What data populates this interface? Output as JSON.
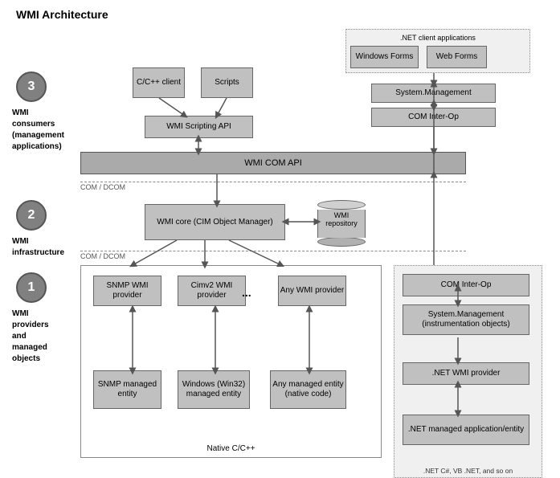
{
  "title": "WMI Architecture",
  "sections": {
    "consumers": {
      "number": "3",
      "label": "WMI consumers\n(management\napplications)"
    },
    "infrastructure": {
      "number": "2",
      "label": "WMI infrastructure"
    },
    "providers": {
      "number": "1",
      "label": "WMI providers\nand\nmanaged\nobjects"
    }
  },
  "boxes": {
    "ccpp_client": "C/C++\nclient",
    "scripts": "Scripts",
    "wmi_scripting_api": "WMI Scripting API",
    "wmi_com_api": "WMI COM API",
    "wmi_core": "WMI core\n(CIM Object Manager)",
    "wmi_repository": "WMI\nrepository",
    "snmp_provider": "SNMP WMI\nprovider",
    "cimv2_provider": "Cimv2 WMI\nprovider",
    "any_provider": "Any WMI\nprovider",
    "snmp_managed": "SNMP\nmanaged\nentity",
    "windows_managed": "Windows (Win32)\nmanaged\nentity",
    "any_managed": "Any managed\nentity\n(native code)",
    "native_label": "Native C/C++",
    "ellipsis": "...",
    "com_interop_top": "COM Inter-Op",
    "system_mgmt_top": "System.Management",
    "windows_forms": "Windows Forms",
    "web_forms": "Web Forms",
    "dotnet_client": ".NET client applications",
    "com_interop_right": "COM Inter-Op",
    "system_mgmt_right": "System.Management\n(instrumentation objects)",
    "dotnet_wmi_provider": ".NET WMI provider",
    "dotnet_managed": ".NET managed\napplication/entity",
    "dotnet_label": ".NET C#, VB .NET, and so on",
    "com_dcom_top": "COM / DCOM",
    "com_dcom_bottom": "COM / DCOM"
  }
}
